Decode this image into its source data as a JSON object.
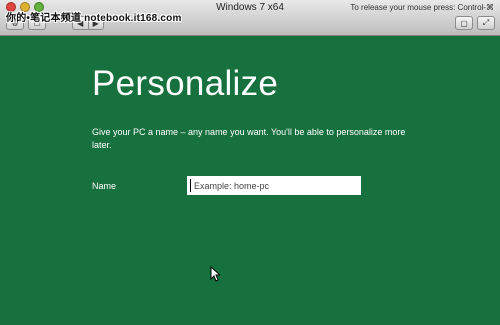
{
  "window": {
    "title": "Windows 7 x64",
    "release_hint": "To release your mouse press: Control-⌘",
    "watermark": "你的•笔记本频道 notebook.it168.com"
  },
  "icons": {
    "back": "◀",
    "forward": "▶",
    "settings": "⚙",
    "screenshot": "▢",
    "fullscreen": "⤢"
  },
  "personalize": {
    "heading": "Personalize",
    "description": "Give your PC a name – any name you want. You'll be able to personalize more later.",
    "name_label": "Name",
    "name_placeholder": "Example: home-pc"
  }
}
